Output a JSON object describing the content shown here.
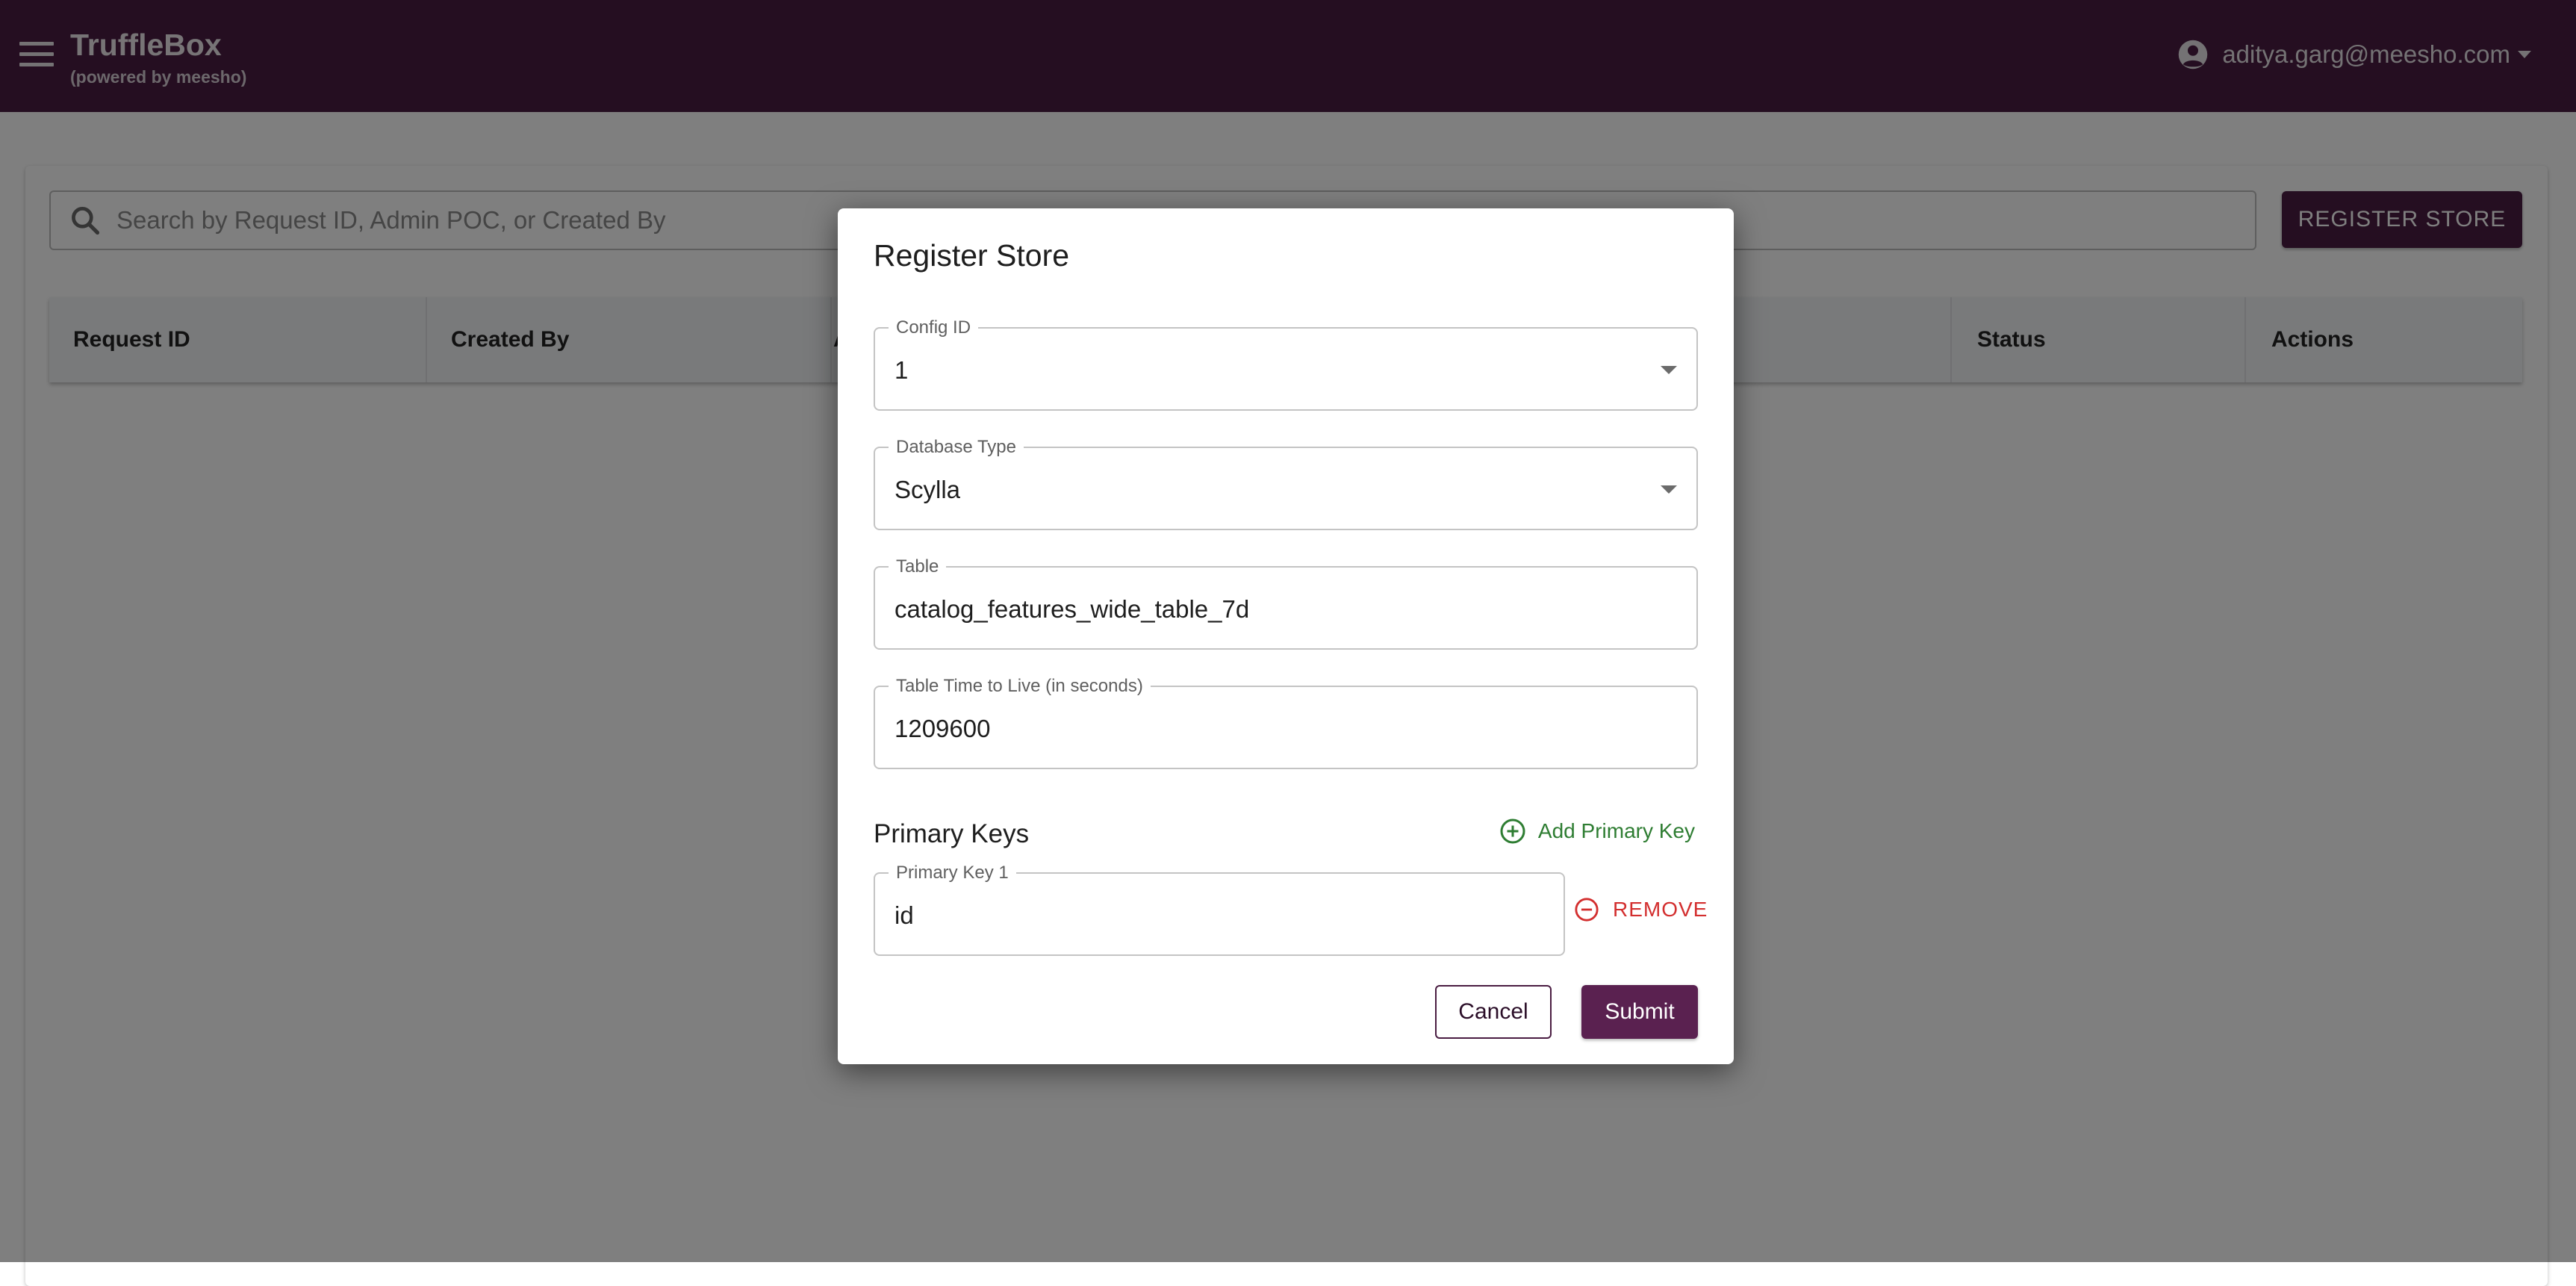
{
  "app": {
    "title": "TruffleBox",
    "subtitle": "(powered by meesho)",
    "user_email": "aditya.garg@meesho.com"
  },
  "colors": {
    "brand": "#4a1d42",
    "add_action": "#2e7d32",
    "remove_action": "#d32f2f"
  },
  "icons": {
    "menu": "menu-icon",
    "account": "account-circle-icon",
    "search": "search-icon",
    "add": "add-circle-outline-icon",
    "remove": "remove-circle-outline-icon",
    "dropdown": "arrow-drop-down-icon"
  },
  "search": {
    "placeholder": "Search by Request ID, Admin POC, or Created By"
  },
  "toolbar": {
    "register_label": "REGISTER STORE"
  },
  "table": {
    "columns": [
      "Request ID",
      "Created By",
      "A",
      "Status",
      "Actions"
    ]
  },
  "dialog": {
    "title": "Register Store",
    "config_id": {
      "label": "Config ID",
      "value": "1"
    },
    "database_type": {
      "label": "Database Type",
      "value": "Scylla"
    },
    "table": {
      "label": "Table",
      "value": "catalog_features_wide_table_7d"
    },
    "ttl": {
      "label": "Table Time to Live (in seconds)",
      "value": "1209600"
    },
    "primary_keys_title": "Primary Keys",
    "add_primary_key_label": "Add Primary Key",
    "primary_keys": [
      {
        "label": "Primary Key 1",
        "value": "id"
      }
    ],
    "remove_label": "REMOVE",
    "cancel_label": "Cancel",
    "submit_label": "Submit"
  }
}
